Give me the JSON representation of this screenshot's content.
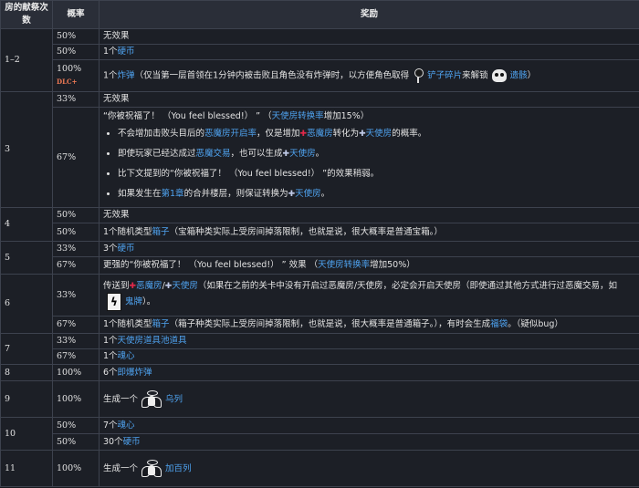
{
  "header": {
    "col_count": "房的献祭次数",
    "col_prob": "概率",
    "col_reward": "奖励"
  },
  "rows": {
    "r1": {
      "count": "1–2",
      "a": {
        "prob": "50%",
        "text": "无效果"
      },
      "b": {
        "prob": "50%",
        "pre": "1个",
        "link": "硬币"
      },
      "c": {
        "prob": "100%",
        "dlc": "DLC+",
        "pre": "1个",
        "link1": "炸弹",
        "mid": "（仅当第一层首领在1分钟内被击败且角色没有炸弹时，以方便角色取得",
        "link2": "铲子碎片",
        "mid2": "来解锁",
        "link3": "遗骸",
        "post": "）"
      }
    },
    "r3": {
      "count": "3",
      "a": {
        "prob": "33%",
        "text": "无效果"
      },
      "b": {
        "prob": "67%",
        "head_pre": "“你被祝福了！ （You feel blessed!） ” （",
        "head_link": "天使房转换率",
        "head_post": "增加15%）",
        "bullet1_pre": "不会增加击败头目后的",
        "bullet1_link": "恶魔房开启率",
        "bullet1_mid": "，仅是增加",
        "bullet1_link2": "恶魔房",
        "bullet1_mid2": "转化为",
        "bullet1_link3": "天使房",
        "bullet1_post": "的概率。",
        "bullet2_pre": "即使玩家已经达成过",
        "bullet2_link": "恶魔交易",
        "bullet2_mid": "，也可以生成",
        "bullet2_link2": "天使房",
        "bullet2_post": "。",
        "bullet3": "比下文提到的“你被祝福了！ （You feel blessed!） ”的效果稍弱。",
        "bullet4_pre": "如果发生在",
        "bullet4_link": "第1章",
        "bullet4_mid": "的合并楼层，则保证转换为",
        "bullet4_link2": "天使房",
        "bullet4_post": "。"
      }
    },
    "r4": {
      "count": "4",
      "a": {
        "prob": "50%",
        "text": "无效果"
      },
      "b": {
        "prob": "50%",
        "pre": "1个随机类型",
        "link": "箱子",
        "post": "（宝箱种类实际上受房间掉落限制，也就是说，很大概率是普通宝箱。）"
      }
    },
    "r5": {
      "count": "5",
      "a": {
        "prob": "33%",
        "pre": "3个",
        "link": "硬币"
      },
      "b": {
        "prob": "67%",
        "pre": "更强的“你被祝福了！ （You feel blessed!） ” 效果 （",
        "link": "天使房转换率",
        "post": "增加50%）"
      }
    },
    "r6": {
      "count": "6",
      "a": {
        "prob": "33%",
        "pre": "传送到",
        "link1": "恶魔房",
        "slash": "/",
        "link2": "天使房",
        "mid": "（如果在之前的关卡中没有开启过恶魔房/天使房，必定会开启天使房（即使通过其他方式进行过恶魔交易，如",
        "link3": "鬼牌",
        "post": "）。"
      },
      "b": {
        "prob": "67%",
        "pre": "1个随机类型",
        "link": "箱子",
        "mid": "（箱子种类实际上受房间掉落限制，也就是说，很大概率是普通箱子。），有时会生成",
        "link2": "福袋",
        "post": "。（疑似bug）"
      }
    },
    "r7": {
      "count": "7",
      "a": {
        "prob": "33%",
        "pre": "1个",
        "link": "天使房道具池道具"
      },
      "b": {
        "prob": "67%",
        "pre": "1个",
        "link": "魂心"
      }
    },
    "r8": {
      "count": "8",
      "a": {
        "prob": "100%",
        "pre": "6个",
        "link": "即爆炸弹"
      }
    },
    "r9": {
      "count": "9",
      "a": {
        "prob": "100%",
        "pre": "生成一个",
        "link": "乌列"
      }
    },
    "r10": {
      "count": "10",
      "a": {
        "prob": "50%",
        "pre": "7个",
        "link": "魂心"
      },
      "b": {
        "prob": "50%",
        "pre": "30个",
        "link": "硬币"
      }
    },
    "r11": {
      "count": "11",
      "a": {
        "prob": "100%",
        "pre": "生成一个",
        "link": "加百列"
      }
    }
  },
  "icons": {
    "key": "key-icon",
    "skull": "skull-icon",
    "heart": "red-heart-icon",
    "star": "angel-star-icon",
    "card": "joker-card-icon",
    "angel": "angel-icon"
  }
}
